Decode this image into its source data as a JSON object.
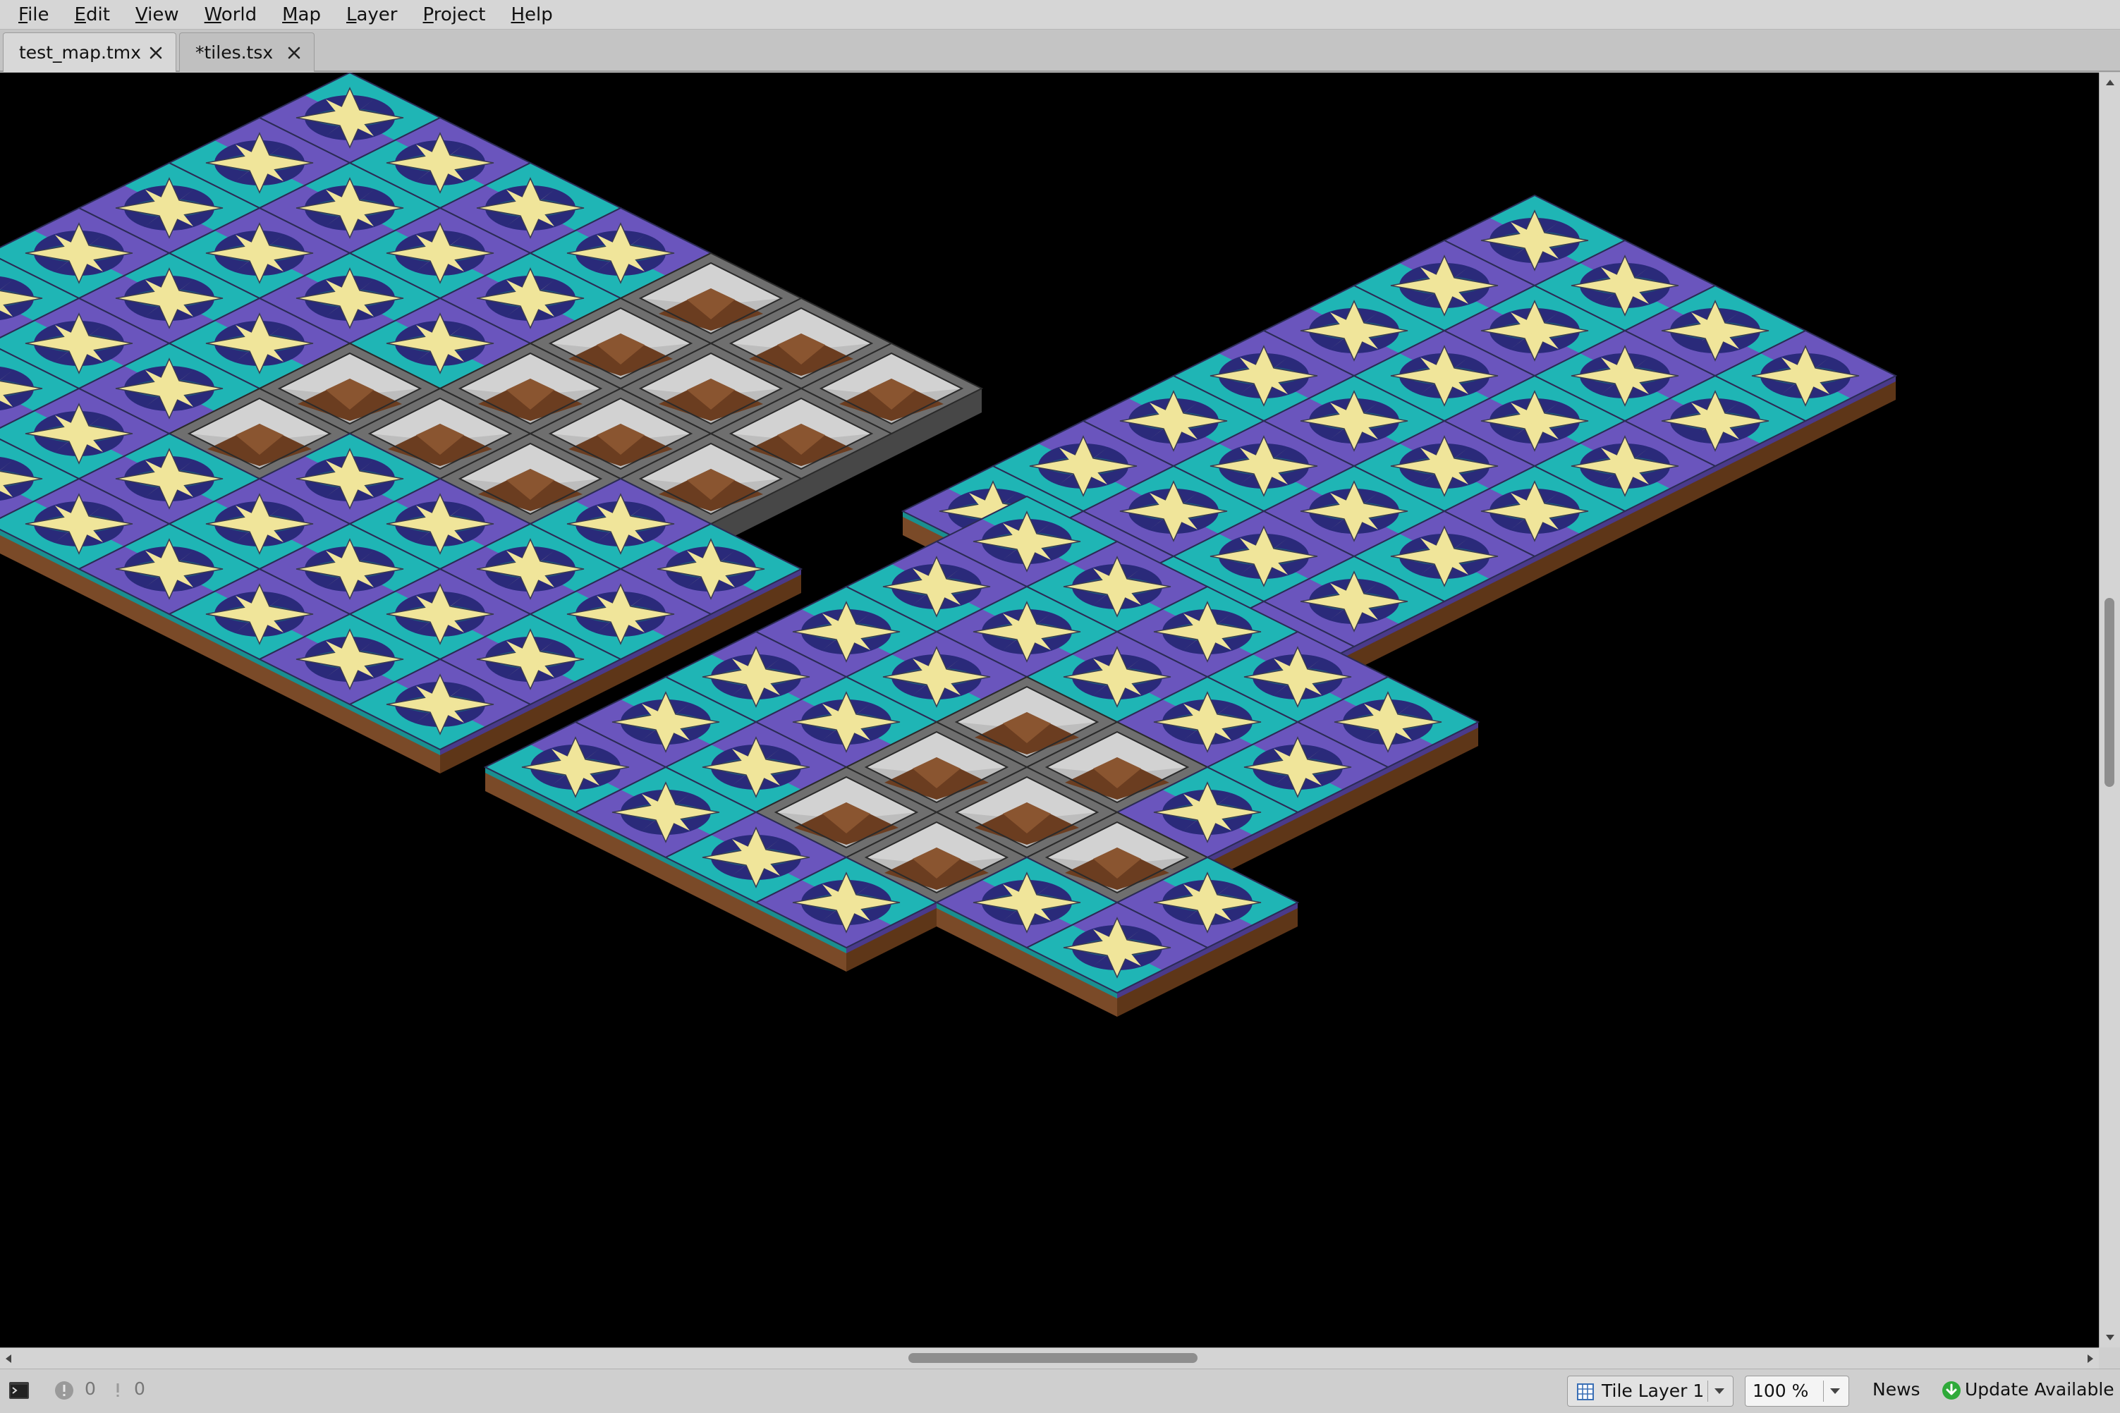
{
  "menu": {
    "items": [
      {
        "label": "File",
        "mnemonic": "F",
        "rest": "ile"
      },
      {
        "label": "Edit",
        "mnemonic": "E",
        "rest": "dit"
      },
      {
        "label": "View",
        "mnemonic": "V",
        "rest": "iew"
      },
      {
        "label": "World",
        "mnemonic": "W",
        "rest": "orld"
      },
      {
        "label": "Map",
        "mnemonic": "M",
        "rest": "ap"
      },
      {
        "label": "Layer",
        "mnemonic": "L",
        "rest": "ayer"
      },
      {
        "label": "Project",
        "mnemonic": "P",
        "rest": "roject"
      },
      {
        "label": "Help",
        "mnemonic": "H",
        "rest": "elp"
      }
    ]
  },
  "tabs": [
    {
      "label": "test_map.tmx",
      "active": true
    },
    {
      "label": "*tiles.tsx",
      "active": false
    }
  ],
  "statusbar": {
    "error_count": "0",
    "warning_count": "0",
    "layer_label": "Tile Layer 1",
    "zoom_label": "100 %",
    "news_label": "News",
    "update_label": "Update Available"
  },
  "colors": {
    "purple_tile": "#6a55bd",
    "teal_tile": "#1fb5b5",
    "star": "#f0e59a",
    "dark_circle": "#2a2a7a",
    "dark_teal": "#1a5d80",
    "dirt": "#7a4a28",
    "stone": "#6f6f6f",
    "stone_light": "#bdbdbd",
    "pit": "#6b3d20",
    "update_green": "#2faa3a"
  },
  "icons": {
    "tab_close": "close-icon",
    "console": "console-icon",
    "error": "error-icon",
    "warning": "warning-icon",
    "layer": "tile-layer-icon",
    "update": "download-icon"
  },
  "map": {
    "orientation": "isometric",
    "islands": [
      {
        "name": "top-left",
        "rows": [
          "ppppbbb",
          "ppppbbb",
          "ppppbbb",
          "pppbbbpp",
          "pppbpppp",
          "pppppppp",
          "pppppppp"
        ]
      },
      {
        "name": "right",
        "rows": [
          "pppp",
          "pppp",
          "pppp",
          "pppp",
          "pppp",
          "pppp",
          "pppp"
        ]
      },
      {
        "name": "center",
        "rows": [
          "ppppp",
          "ppppp",
          "ppbbp",
          "ppbbbp",
          "ppbbpp",
          "pppp"
        ]
      }
    ]
  }
}
